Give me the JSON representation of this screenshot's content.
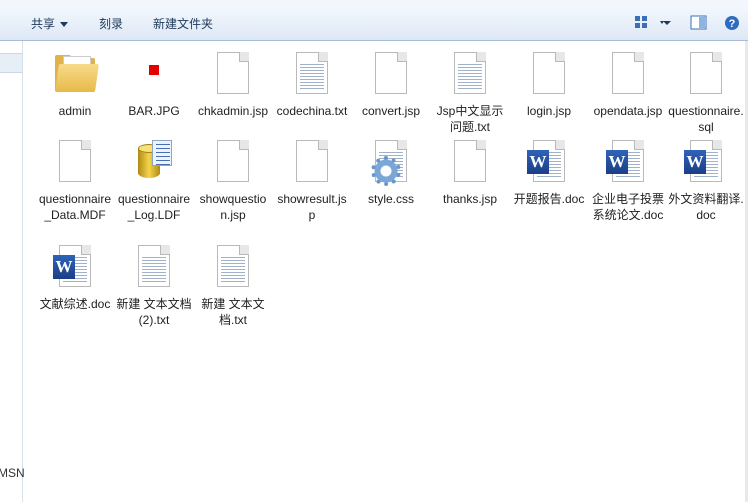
{
  "toolbar": {
    "share_label": "共享",
    "burn_label": "刻录",
    "new_folder_label": "新建文件夹"
  },
  "nav": {
    "partial_label": "MSN"
  },
  "files": [
    {
      "name": "admin",
      "icon": "folder-icon"
    },
    {
      "name": "BAR.JPG",
      "icon": "jpg-image-icon"
    },
    {
      "name": "chkadmin.jsp",
      "icon": "blank-file-icon"
    },
    {
      "name": "codechina.txt",
      "icon": "text-file-icon"
    },
    {
      "name": "convert.jsp",
      "icon": "blank-file-icon"
    },
    {
      "name": "Jsp中文显示问题.txt",
      "icon": "text-file-icon"
    },
    {
      "name": "login.jsp",
      "icon": "blank-file-icon"
    },
    {
      "name": "opendata.jsp",
      "icon": "blank-file-icon"
    },
    {
      "name": "questionnaire.sql",
      "icon": "blank-file-icon"
    },
    {
      "name": "questionnaire_Data.MDF",
      "icon": "blank-file-icon"
    },
    {
      "name": "questionnaire_Log.LDF",
      "icon": "database-file-icon"
    },
    {
      "name": "showquestion.jsp",
      "icon": "blank-file-icon"
    },
    {
      "name": "showresult.jsp",
      "icon": "blank-file-icon"
    },
    {
      "name": "style.css",
      "icon": "css-file-icon"
    },
    {
      "name": "thanks.jsp",
      "icon": "blank-file-icon"
    },
    {
      "name": "开题报告.doc",
      "icon": "word-doc-icon"
    },
    {
      "name": "企业电子投票系统论文.doc",
      "icon": "word-doc-icon"
    },
    {
      "name": "外文资料翻译.doc",
      "icon": "word-doc-icon"
    },
    {
      "name": "文献综述.doc",
      "icon": "word-doc-icon"
    },
    {
      "name": "新建 文本文档 (2).txt",
      "icon": "text-file-icon"
    },
    {
      "name": "新建 文本文档.txt",
      "icon": "text-file-icon"
    }
  ]
}
